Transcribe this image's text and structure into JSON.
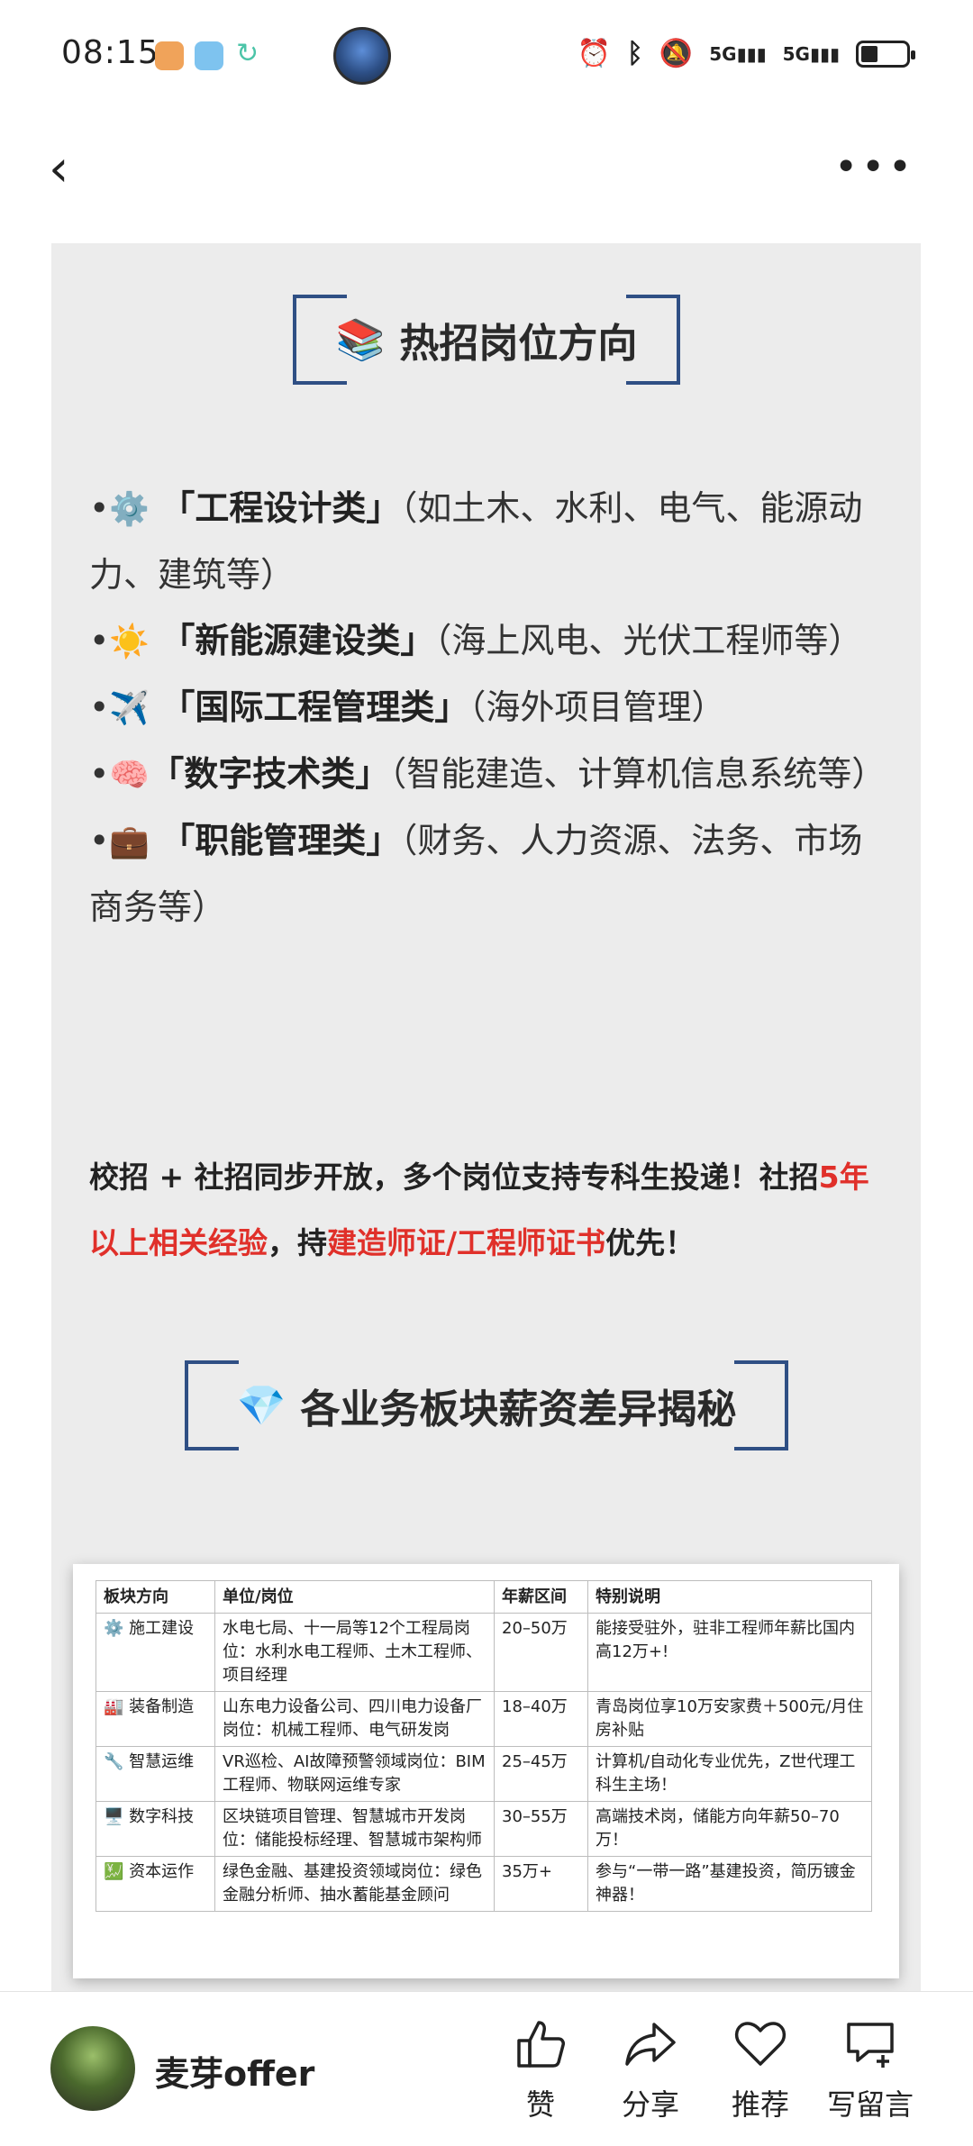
{
  "status": {
    "time": "08:15",
    "network1": "5G",
    "network2": "5G"
  },
  "sections": {
    "hot_title": "热招岗位方向",
    "salary_title": "各业务板块薪资差异揭秘"
  },
  "positions": [
    {
      "emoji": "⚙️",
      "name": "「工程设计类」",
      "desc": "（如土木、水利、电气、能源动力、建筑等）"
    },
    {
      "emoji": "☀️",
      "name": "「新能源建设类」",
      "desc": "（海上风电、光伏工程师等）"
    },
    {
      "emoji": "✈️",
      "name": "「国际工程管理类」",
      "desc": "（海外项目管理）"
    },
    {
      "emoji": "🧠",
      "name": "「数字技术类」",
      "desc": "（智能建造、计算机信息系统等）"
    },
    {
      "emoji": "💼",
      "name": "「职能管理类」",
      "desc": "（财务、人力资源、法务、市场商务等）"
    }
  ],
  "note": {
    "part1": "校招 + 社招同步开放，多个岗位支持专科生投递！社招",
    "red1": "5年以上相关经验",
    "part2": "，持",
    "red2": "建造师证/工程师证书",
    "part3": "优先！"
  },
  "table": {
    "headers": [
      "板块方向",
      "单位/岗位",
      "年薪区间",
      "特别说明"
    ],
    "rows": [
      {
        "icon": "⚙️",
        "sector": "施工建设",
        "unit": "水电七局、十一局等12个工程局岗位：水利水电工程师、土木工程师、项目经理",
        "salary": "20–50万",
        "note": "能接受驻外，驻非工程师年薪比国内高12万+!"
      },
      {
        "icon": "🏭",
        "sector": "装备制造",
        "unit": "山东电力设备公司、四川电力设备厂岗位：机械工程师、电气研发岗",
        "salary": "18–40万",
        "note": "青岛岗位享10万安家费＋500元/月住房补贴"
      },
      {
        "icon": "🔧",
        "sector": "智慧运维",
        "unit": "VR巡检、AI故障预警领域岗位：BIM工程师、物联网运维专家",
        "salary": "25–45万",
        "note": "计算机/自动化专业优先，Z世代理工科生主场！"
      },
      {
        "icon": "🖥️",
        "sector": "数字科技",
        "unit": "区块链项目管理、智慧城市开发岗位：储能投标经理、智慧城市架构师",
        "salary": "30–55万",
        "note": "高端技术岗，储能方向年薪50–70万！"
      },
      {
        "icon": "💹",
        "sector": "资本运作",
        "unit": "绿色金融、基建投资领域岗位：绿色金融分析师、抽水蓄能基金顾问",
        "salary": "35万+",
        "note": "参与“一带一路”基建投资，简历镀金神器！"
      }
    ]
  },
  "author": {
    "name": "麦芽offer"
  },
  "actions": {
    "like": "赞",
    "share": "分享",
    "recommend": "推荐",
    "comment": "写留言"
  }
}
